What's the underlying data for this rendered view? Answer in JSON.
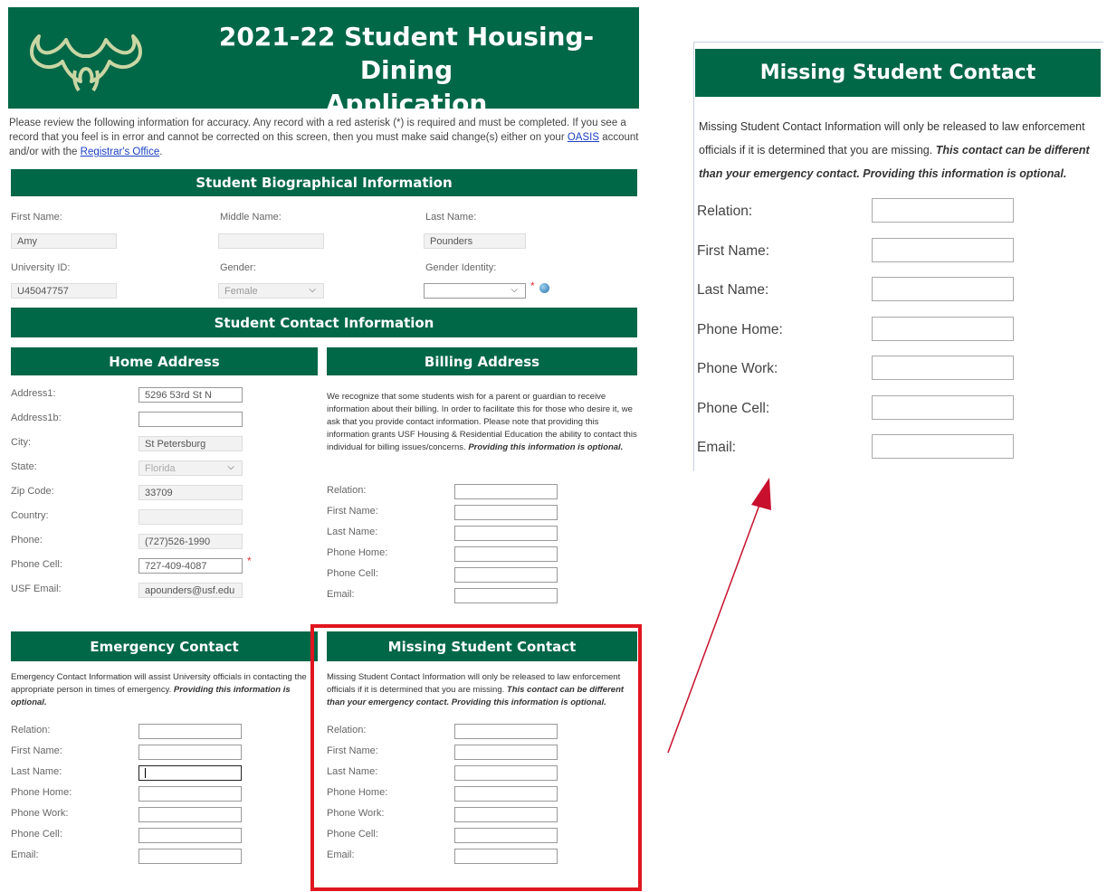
{
  "header": {
    "title_line1": "2021-22 Student Housing-Dining",
    "title_line2": "Application"
  },
  "intro": {
    "text": "Please review the following information for accuracy. Any record with a red asterisk (*) is required and must be completed. If you see a record that you feel is in error and cannot be corrected on this screen, then you must make said change(s) either on your ",
    "link_oasis": "OASIS",
    "mid": " account and/or with the ",
    "link_registrar": "Registrar's Office",
    "end": "."
  },
  "bio": {
    "heading": "Student Biographical Information",
    "first_name_label": "First Name:",
    "middle_name_label": "Middle Name:",
    "last_name_label": "Last Name:",
    "first_name": "Amy",
    "middle_name": "",
    "last_name": "Pounders",
    "university_id_label": "University ID:",
    "gender_label": "Gender:",
    "gender_identity_label": "Gender Identity:",
    "university_id": "U45047757",
    "gender": "Female",
    "gender_identity": "",
    "required_mark": "*"
  },
  "contact_heading": "Student Contact Information",
  "home": {
    "heading": "Home Address",
    "rows": [
      {
        "label": "Address1:",
        "value": "5296 53rd St N"
      },
      {
        "label": "Address1b:",
        "value": ""
      },
      {
        "label": "City:",
        "value": "St Petersburg"
      },
      {
        "label": "State:",
        "value": "Florida"
      },
      {
        "label": "Zip Code:",
        "value": "33709"
      },
      {
        "label": "Country:",
        "value": ""
      },
      {
        "label": "Phone:",
        "value": "(727)526-1990"
      },
      {
        "label": "Phone Cell:",
        "value": "727-409-4087"
      },
      {
        "label": "USF Email:",
        "value": "apounders@usf.edu"
      }
    ]
  },
  "billing": {
    "heading": "Billing Address",
    "text": "We recognize that some students wish for a parent or guardian to receive information about their billing. In order to facilitate this for those who desire it, we ask that you provide contact information. Please note that providing this information grants USF Housing & Residential Education the ability to contact this individual for billing issues/concerns. ",
    "text_bold": "Providing this information is optional.",
    "rows": [
      "Relation:",
      "First Name:",
      "Last Name:",
      "Phone Home:",
      "Phone Cell:",
      "Email:"
    ]
  },
  "emergency": {
    "heading": "Emergency Contact",
    "text": "Emergency Contact Information will assist University officials in contacting the appropriate person in times of emergency. ",
    "text_bold": "Providing this information is optional.",
    "rows": [
      "Relation:",
      "First Name:",
      "Last Name:",
      "Phone Home:",
      "Phone Work:",
      "Phone Cell:",
      "Email:"
    ]
  },
  "missing": {
    "heading": "Missing Student Contact",
    "text": "Missing Student Contact Information will only be released to law enforcement officials if it is determined that you are missing. ",
    "text_bold": "This contact can be different than your emergency contact. Providing this information is optional.",
    "rows": [
      "Relation:",
      "First Name:",
      "Last Name:",
      "Phone Home:",
      "Phone Work:",
      "Phone Cell:",
      "Email:"
    ]
  },
  "colors": {
    "usf_green": "#006747",
    "highlight_red": "#e0161f",
    "arrow_red": "#c8102e"
  }
}
